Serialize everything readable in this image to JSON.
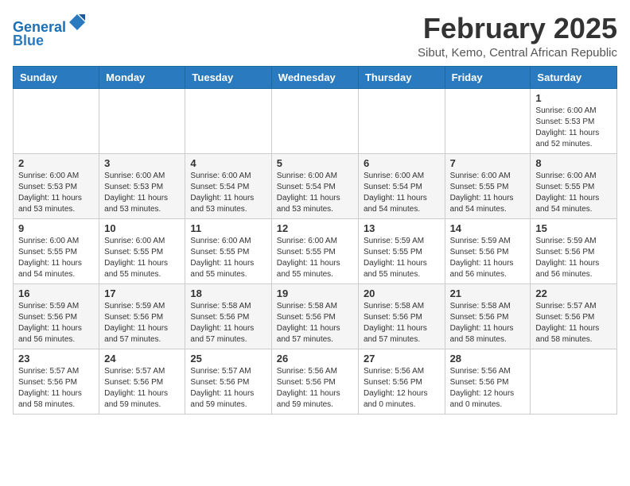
{
  "header": {
    "logo_general": "General",
    "logo_blue": "Blue",
    "month_year": "February 2025",
    "location": "Sibut, Kemo, Central African Republic"
  },
  "weekdays": [
    "Sunday",
    "Monday",
    "Tuesday",
    "Wednesday",
    "Thursday",
    "Friday",
    "Saturday"
  ],
  "weeks": [
    [
      {
        "day": "",
        "info": ""
      },
      {
        "day": "",
        "info": ""
      },
      {
        "day": "",
        "info": ""
      },
      {
        "day": "",
        "info": ""
      },
      {
        "day": "",
        "info": ""
      },
      {
        "day": "",
        "info": ""
      },
      {
        "day": "1",
        "info": "Sunrise: 6:00 AM\nSunset: 5:53 PM\nDaylight: 11 hours\nand 52 minutes."
      }
    ],
    [
      {
        "day": "2",
        "info": "Sunrise: 6:00 AM\nSunset: 5:53 PM\nDaylight: 11 hours\nand 53 minutes."
      },
      {
        "day": "3",
        "info": "Sunrise: 6:00 AM\nSunset: 5:53 PM\nDaylight: 11 hours\nand 53 minutes."
      },
      {
        "day": "4",
        "info": "Sunrise: 6:00 AM\nSunset: 5:54 PM\nDaylight: 11 hours\nand 53 minutes."
      },
      {
        "day": "5",
        "info": "Sunrise: 6:00 AM\nSunset: 5:54 PM\nDaylight: 11 hours\nand 53 minutes."
      },
      {
        "day": "6",
        "info": "Sunrise: 6:00 AM\nSunset: 5:54 PM\nDaylight: 11 hours\nand 54 minutes."
      },
      {
        "day": "7",
        "info": "Sunrise: 6:00 AM\nSunset: 5:55 PM\nDaylight: 11 hours\nand 54 minutes."
      },
      {
        "day": "8",
        "info": "Sunrise: 6:00 AM\nSunset: 5:55 PM\nDaylight: 11 hours\nand 54 minutes."
      }
    ],
    [
      {
        "day": "9",
        "info": "Sunrise: 6:00 AM\nSunset: 5:55 PM\nDaylight: 11 hours\nand 54 minutes."
      },
      {
        "day": "10",
        "info": "Sunrise: 6:00 AM\nSunset: 5:55 PM\nDaylight: 11 hours\nand 55 minutes."
      },
      {
        "day": "11",
        "info": "Sunrise: 6:00 AM\nSunset: 5:55 PM\nDaylight: 11 hours\nand 55 minutes."
      },
      {
        "day": "12",
        "info": "Sunrise: 6:00 AM\nSunset: 5:55 PM\nDaylight: 11 hours\nand 55 minutes."
      },
      {
        "day": "13",
        "info": "Sunrise: 5:59 AM\nSunset: 5:55 PM\nDaylight: 11 hours\nand 55 minutes."
      },
      {
        "day": "14",
        "info": "Sunrise: 5:59 AM\nSunset: 5:56 PM\nDaylight: 11 hours\nand 56 minutes."
      },
      {
        "day": "15",
        "info": "Sunrise: 5:59 AM\nSunset: 5:56 PM\nDaylight: 11 hours\nand 56 minutes."
      }
    ],
    [
      {
        "day": "16",
        "info": "Sunrise: 5:59 AM\nSunset: 5:56 PM\nDaylight: 11 hours\nand 56 minutes."
      },
      {
        "day": "17",
        "info": "Sunrise: 5:59 AM\nSunset: 5:56 PM\nDaylight: 11 hours\nand 57 minutes."
      },
      {
        "day": "18",
        "info": "Sunrise: 5:58 AM\nSunset: 5:56 PM\nDaylight: 11 hours\nand 57 minutes."
      },
      {
        "day": "19",
        "info": "Sunrise: 5:58 AM\nSunset: 5:56 PM\nDaylight: 11 hours\nand 57 minutes."
      },
      {
        "day": "20",
        "info": "Sunrise: 5:58 AM\nSunset: 5:56 PM\nDaylight: 11 hours\nand 57 minutes."
      },
      {
        "day": "21",
        "info": "Sunrise: 5:58 AM\nSunset: 5:56 PM\nDaylight: 11 hours\nand 58 minutes."
      },
      {
        "day": "22",
        "info": "Sunrise: 5:57 AM\nSunset: 5:56 PM\nDaylight: 11 hours\nand 58 minutes."
      }
    ],
    [
      {
        "day": "23",
        "info": "Sunrise: 5:57 AM\nSunset: 5:56 PM\nDaylight: 11 hours\nand 58 minutes."
      },
      {
        "day": "24",
        "info": "Sunrise: 5:57 AM\nSunset: 5:56 PM\nDaylight: 11 hours\nand 59 minutes."
      },
      {
        "day": "25",
        "info": "Sunrise: 5:57 AM\nSunset: 5:56 PM\nDaylight: 11 hours\nand 59 minutes."
      },
      {
        "day": "26",
        "info": "Sunrise: 5:56 AM\nSunset: 5:56 PM\nDaylight: 11 hours\nand 59 minutes."
      },
      {
        "day": "27",
        "info": "Sunrise: 5:56 AM\nSunset: 5:56 PM\nDaylight: 12 hours\nand 0 minutes."
      },
      {
        "day": "28",
        "info": "Sunrise: 5:56 AM\nSunset: 5:56 PM\nDaylight: 12 hours\nand 0 minutes."
      },
      {
        "day": "",
        "info": ""
      }
    ]
  ]
}
